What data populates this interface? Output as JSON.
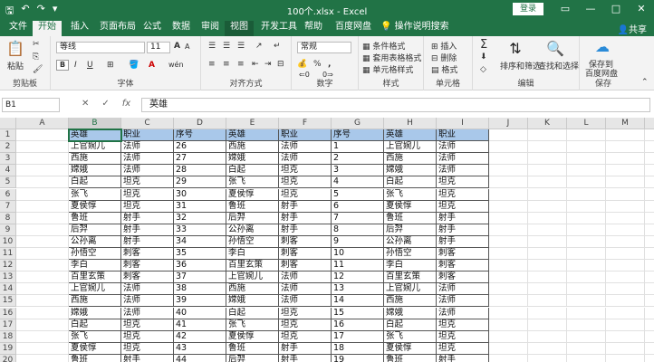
{
  "window": {
    "title": "100个.xlsx - Excel",
    "login_label": "登录",
    "min": "—",
    "max": "□",
    "close": "✕"
  },
  "tabs": [
    {
      "label": "文件"
    },
    {
      "label": "开始",
      "active": true
    },
    {
      "label": "插入"
    },
    {
      "label": "页面布局"
    },
    {
      "label": "公式"
    },
    {
      "label": "数据"
    },
    {
      "label": "审阅"
    },
    {
      "label": "视图"
    },
    {
      "label": "开发工具"
    },
    {
      "label": "帮助"
    },
    {
      "label": "百度网盘"
    },
    {
      "label": "操作说明搜索"
    }
  ],
  "share_label": "共享",
  "ribbon": {
    "clipboard": {
      "label": "剪贴板",
      "paste": "粘贴"
    },
    "font": {
      "label": "字体",
      "name": "等线",
      "size": "11",
      "bold": "B",
      "italic": "I",
      "underline": "U",
      "grow": "A",
      "shrink": "A",
      "font_color": "A",
      "wen": "wén"
    },
    "align": {
      "label": "对齐方式"
    },
    "number": {
      "label": "数字",
      "format": "常规",
      "percent": "%",
      "comma": ","
    },
    "styles": {
      "label": "样式",
      "cond": "条件格式",
      "table": "套用表格格式",
      "cell": "单元格样式"
    },
    "cells": {
      "label": "单元格",
      "insert": "插入",
      "delete": "删除",
      "format": "格式"
    },
    "editing": {
      "label": "编辑",
      "sum": "Σ",
      "sort": "排序和筛选",
      "find": "查找和选择"
    },
    "save": {
      "label": "保存",
      "btn1": "保存到",
      "btn2": "百度网盘"
    }
  },
  "formula_bar": {
    "name_box": "B1",
    "cancel": "✕",
    "enter": "✓",
    "fx": "fx",
    "value": "英雄"
  },
  "columns": [
    "A",
    "B",
    "C",
    "D",
    "E",
    "F",
    "G",
    "H",
    "I",
    "J",
    "K",
    "L",
    "M",
    "N"
  ],
  "rows": [
    [
      "英雄",
      "职业",
      "序号",
      "英雄",
      "职业",
      "序号",
      "英雄",
      "职业"
    ],
    [
      "上官婉儿",
      "法师",
      "26",
      "西施",
      "法师",
      "1",
      "上官婉儿",
      "法师"
    ],
    [
      "西施",
      "法师",
      "27",
      "嫦娥",
      "法师",
      "2",
      "西施",
      "法师"
    ],
    [
      "嫦娥",
      "法师",
      "28",
      "白起",
      "坦克",
      "3",
      "嫦娥",
      "法师"
    ],
    [
      "白起",
      "坦克",
      "29",
      "张飞",
      "坦克",
      "4",
      "白起",
      "坦克"
    ],
    [
      "张飞",
      "坦克",
      "30",
      "夏侯惇",
      "坦克",
      "5",
      "张飞",
      "坦克"
    ],
    [
      "夏侯惇",
      "坦克",
      "31",
      "鲁班",
      "射手",
      "6",
      "夏侯惇",
      "坦克"
    ],
    [
      "鲁班",
      "射手",
      "32",
      "后羿",
      "射手",
      "7",
      "鲁班",
      "射手"
    ],
    [
      "后羿",
      "射手",
      "33",
      "公孙离",
      "射手",
      "8",
      "后羿",
      "射手"
    ],
    [
      "公孙离",
      "射手",
      "34",
      "孙悟空",
      "刺客",
      "9",
      "公孙离",
      "射手"
    ],
    [
      "孙悟空",
      "刺客",
      "35",
      "李白",
      "刺客",
      "10",
      "孙悟空",
      "刺客"
    ],
    [
      "李白",
      "刺客",
      "36",
      "百里玄策",
      "刺客",
      "11",
      "李白",
      "刺客"
    ],
    [
      "百里玄策",
      "刺客",
      "37",
      "上官婉儿",
      "法师",
      "12",
      "百里玄策",
      "刺客"
    ],
    [
      "上官婉儿",
      "法师",
      "38",
      "西施",
      "法师",
      "13",
      "上官婉儿",
      "法师"
    ],
    [
      "西施",
      "法师",
      "39",
      "嫦娥",
      "法师",
      "14",
      "西施",
      "法师"
    ],
    [
      "嫦娥",
      "法师",
      "40",
      "白起",
      "坦克",
      "15",
      "嫦娥",
      "法师"
    ],
    [
      "白起",
      "坦克",
      "41",
      "张飞",
      "坦克",
      "16",
      "白起",
      "坦克"
    ],
    [
      "张飞",
      "坦克",
      "42",
      "夏侯惇",
      "坦克",
      "17",
      "张飞",
      "坦克"
    ],
    [
      "夏侯惇",
      "坦克",
      "43",
      "鲁班",
      "射手",
      "18",
      "夏侯惇",
      "坦克"
    ],
    [
      "鲁班",
      "射手",
      "44",
      "后羿",
      "射手",
      "19",
      "鲁班",
      "射手"
    ],
    [
      "后羿",
      "射手",
      "45",
      "公孙离",
      "射手",
      "20",
      "后羿",
      "射手"
    ]
  ]
}
